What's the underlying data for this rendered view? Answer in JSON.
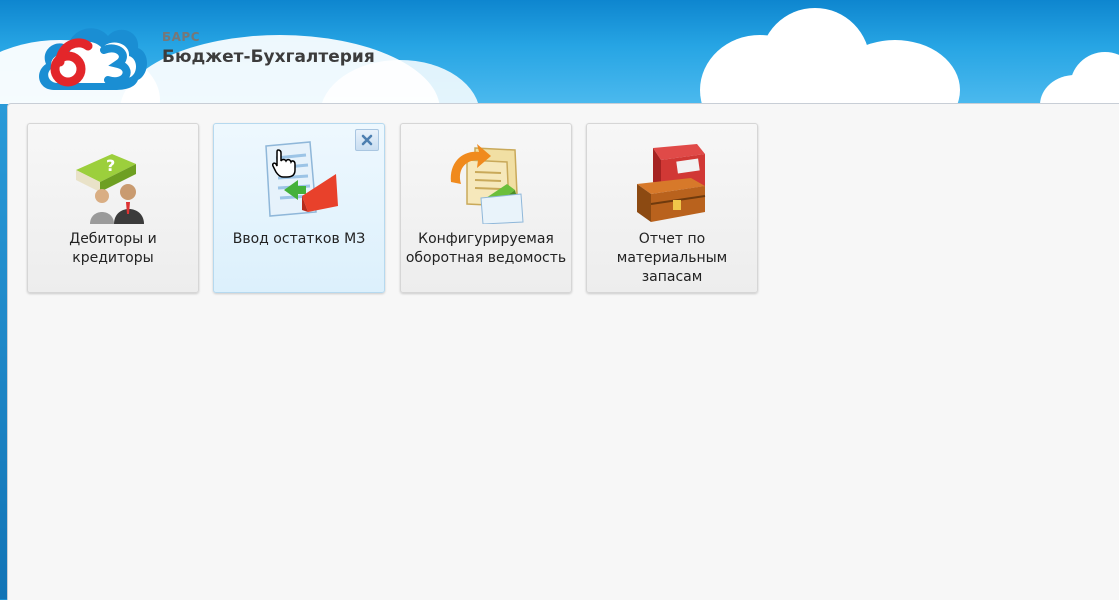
{
  "header": {
    "brand_small": "БАРС",
    "brand_title": "Бюджет-Бухгалтерия",
    "logo_icon": "bars-cloud-logo-icon"
  },
  "tiles": [
    {
      "label": "Дебиторы и\nкредиторы",
      "icon": "book-people-icon",
      "highlighted": false
    },
    {
      "label": "Ввод остатков МЗ",
      "icon": "document-arrow-icon",
      "highlighted": true,
      "remove_icon": "close-icon"
    },
    {
      "label": "Конфигурируемая\nоборотная ведомость",
      "icon": "documents-refresh-icon",
      "highlighted": false
    },
    {
      "label": "Отчет по\nматериальным\nзапасам",
      "icon": "red-book-chest-icon",
      "highlighted": false
    }
  ],
  "colors": {
    "header_blue": "#1e8fd0",
    "workspace_bg": "#f7f7f7",
    "tile_hover": "#dcf0fc",
    "logo_red": "#e3262a",
    "logo_blue": "#1a8ed3"
  }
}
